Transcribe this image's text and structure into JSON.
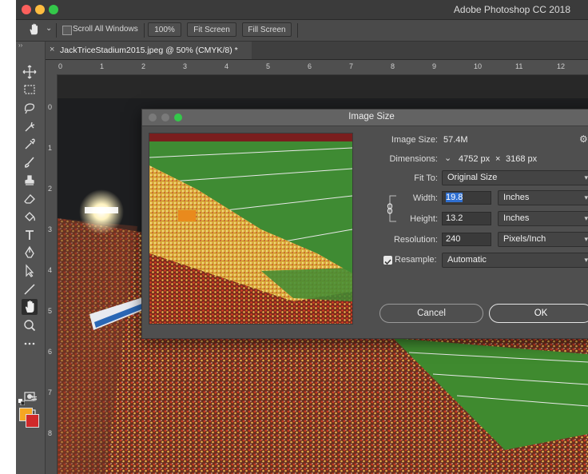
{
  "app_title": "Adobe Photoshop CC 2018",
  "options_bar": {
    "scroll_all_label": "Scroll All Windows",
    "zoom_label": "100%",
    "fit_screen_label": "Fit Screen",
    "fill_screen_label": "Fill Screen"
  },
  "document": {
    "tab_label": "JackTriceStadium2015.jpeg @ 50% (CMYK/8) *",
    "close_glyph": "×",
    "h_ruler": [
      "0",
      "1",
      "2",
      "3",
      "4",
      "5",
      "6",
      "7",
      "8",
      "9",
      "10",
      "11",
      "12"
    ],
    "v_ruler": [
      "0",
      "1",
      "2",
      "3",
      "4",
      "5",
      "6",
      "7",
      "8"
    ]
  },
  "tools": [
    "move-icon",
    "marquee-icon",
    "lasso-icon",
    "quick-select-icon",
    "eyedropper-icon",
    "brush-icon",
    "stamp-icon",
    "eraser-icon",
    "paint-bucket-icon",
    "type-icon",
    "pen-icon",
    "path-select-icon",
    "line-icon",
    "hand-icon",
    "zoom-icon",
    "more-tools-icon",
    "quick-mask-icon",
    "screen-mode-icon"
  ],
  "colors": {
    "foreground": "#f5a623",
    "background": "#d0292a",
    "accent": "#2f6fd0",
    "arrow": "#f6a21b"
  },
  "dialog": {
    "title": "Image Size",
    "image_size_label": "Image Size:",
    "image_size_value": "57.4M",
    "dimensions_label": "Dimensions:",
    "dimensions_w": "4752 px",
    "dimensions_x": "×",
    "dimensions_h": "3168 px",
    "fit_to_label": "Fit To:",
    "fit_to_value": "Original Size",
    "width_label": "Width:",
    "width_value": "19.8",
    "width_unit": "Inches",
    "height_label": "Height:",
    "height_value": "13.2",
    "height_unit": "Inches",
    "resolution_label": "Resolution:",
    "resolution_value": "240",
    "resolution_unit": "Pixels/Inch",
    "resample_label": "Resample:",
    "resample_value": "Automatic",
    "cancel_label": "Cancel",
    "ok_label": "OK"
  }
}
